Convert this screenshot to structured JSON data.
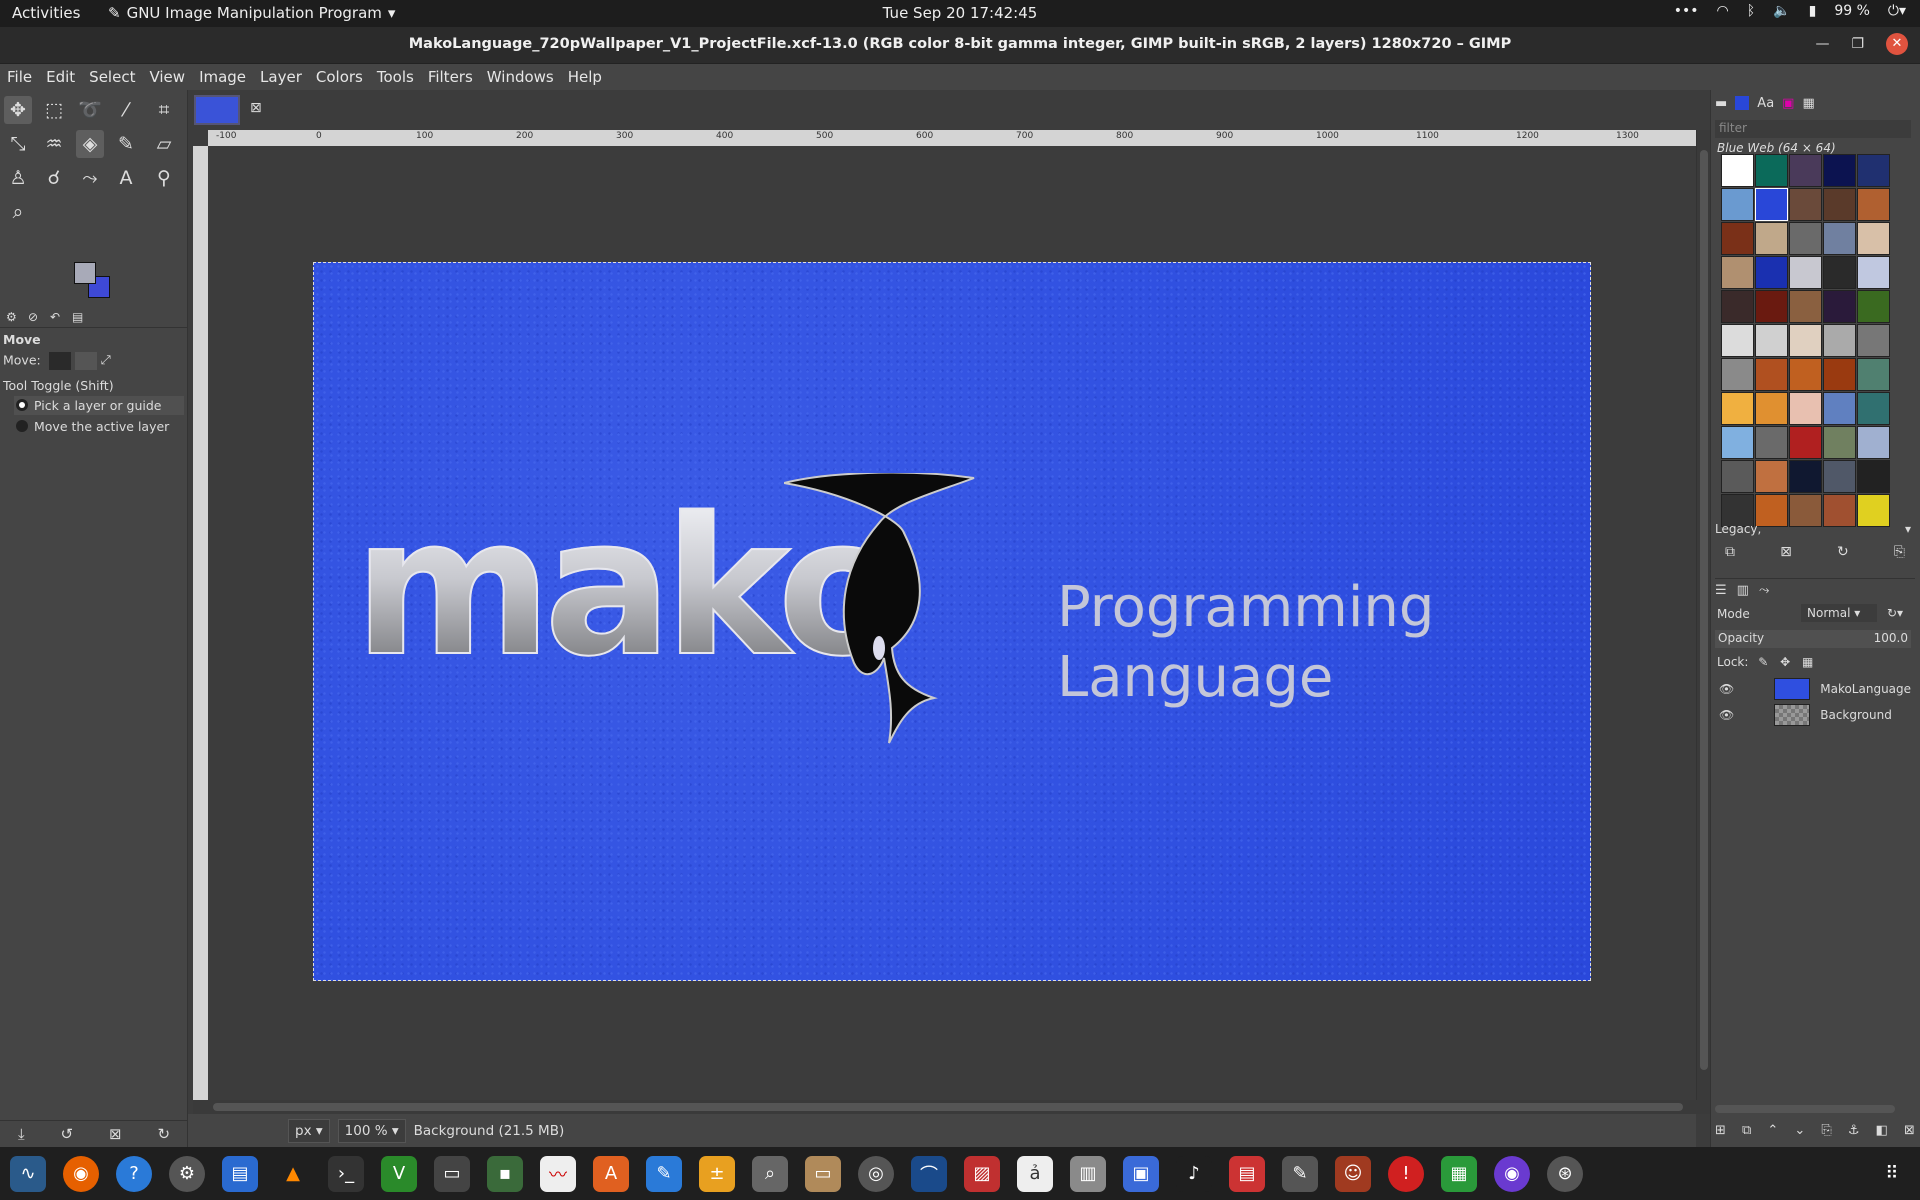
{
  "topbar": {
    "activities": "Activities",
    "app_menu": "GNU Image Manipulation Program",
    "clock": "Tue Sep 20  17:42:45",
    "battery": "99 %"
  },
  "window": {
    "title": "MakoLanguage_720pWallpaper_V1_ProjectFile.xcf-13.0 (RGB color 8-bit gamma integer, GIMP built-in sRGB, 2 layers) 1280x720 – GIMP"
  },
  "menu": [
    "File",
    "Edit",
    "Select",
    "View",
    "Image",
    "Layer",
    "Colors",
    "Tools",
    "Filters",
    "Windows",
    "Help"
  ],
  "tool_options": {
    "title": "Move",
    "move_label": "Move:",
    "toggle_label": "Tool Toggle  (Shift)",
    "option1": "Pick a layer or guide",
    "option2": "Move the active layer"
  },
  "ruler": [
    "-100",
    "0",
    "100",
    "200",
    "300",
    "400",
    "500",
    "600",
    "700",
    "800",
    "900",
    "1000",
    "1100",
    "1200",
    "1300"
  ],
  "canvas": {
    "logo_text": "mako",
    "subtitle_line1": "Programming",
    "subtitle_line2": "Language"
  },
  "status": {
    "unit": "px",
    "zoom": "100 %",
    "info": "Background (21.5 MB)"
  },
  "patterns": {
    "filter_placeholder": "filter",
    "selected_name": "Blue Web (64 × 64)",
    "tag": "Legacy,"
  },
  "layers": {
    "mode_label": "Mode",
    "mode_value": "Normal",
    "opacity_label": "Opacity",
    "opacity_value": "100.0",
    "lock_label": "Lock:",
    "items": [
      {
        "name": "MakoLanguage"
      },
      {
        "name": "Background"
      }
    ]
  },
  "colors": {
    "foreground": "#a8aab8",
    "background": "#3e49d6",
    "canvas_blue": "#2f4fe0"
  }
}
